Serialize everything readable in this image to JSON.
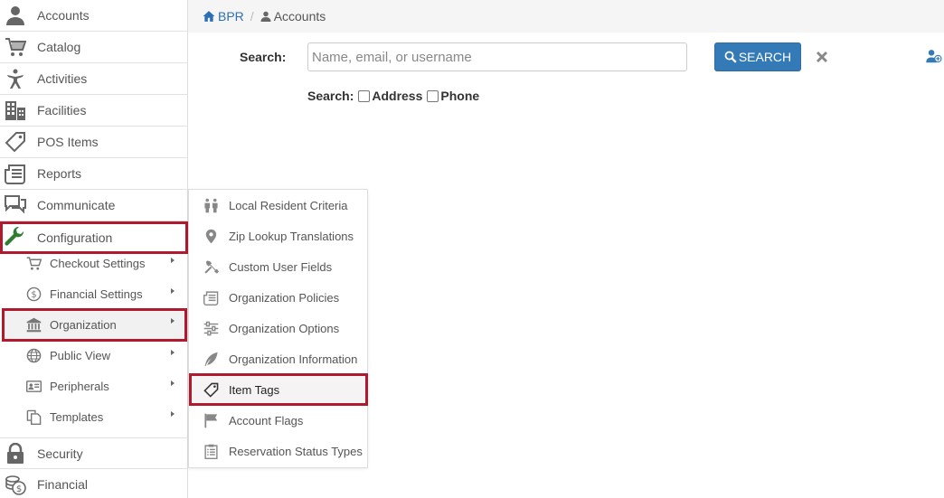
{
  "breadcrumb": {
    "home": "BPR",
    "separator": "/",
    "current": "Accounts"
  },
  "search": {
    "label": "Search:",
    "placeholder": "Name, email, or username",
    "value": "",
    "button_label": "SEARCH",
    "options_label": "Search:",
    "options": [
      "Address",
      "Phone"
    ]
  },
  "sidebar": {
    "items": [
      {
        "label": "Accounts",
        "icon": "user-icon"
      },
      {
        "label": "Catalog",
        "icon": "cart-icon"
      },
      {
        "label": "Activities",
        "icon": "person-activity-icon"
      },
      {
        "label": "Facilities",
        "icon": "building-icon"
      },
      {
        "label": "POS Items",
        "icon": "tag-icon"
      },
      {
        "label": "Reports",
        "icon": "reports-icon"
      },
      {
        "label": "Communicate",
        "icon": "chat-icon"
      },
      {
        "label": "Configuration",
        "icon": "wrench-icon"
      }
    ],
    "sub_items": [
      {
        "label": "Checkout Settings",
        "icon": "cart-icon"
      },
      {
        "label": "Financial Settings",
        "icon": "dollar-circle-icon"
      },
      {
        "label": "Organization",
        "icon": "bank-icon"
      },
      {
        "label": "Public View",
        "icon": "globe-icon"
      },
      {
        "label": "Peripherals",
        "icon": "id-card-icon"
      },
      {
        "label": "Templates",
        "icon": "copy-icon"
      }
    ],
    "bottom_items": [
      {
        "label": "Security",
        "icon": "lock-icon"
      },
      {
        "label": "Financial",
        "icon": "money-icon"
      }
    ]
  },
  "flyout": {
    "items": [
      {
        "label": "Local Resident Criteria",
        "icon": "residents-icon"
      },
      {
        "label": "Zip Lookup Translations",
        "icon": "map-pin-icon"
      },
      {
        "label": "Custom User Fields",
        "icon": "tools-icon"
      },
      {
        "label": "Organization Policies",
        "icon": "policies-icon"
      },
      {
        "label": "Organization Options",
        "icon": "sliders-icon"
      },
      {
        "label": "Organization Information",
        "icon": "feather-icon"
      },
      {
        "label": "Item Tags",
        "icon": "tag-icon"
      },
      {
        "label": "Account Flags",
        "icon": "flag-icon"
      },
      {
        "label": "Reservation Status Types",
        "icon": "clipboard-icon"
      }
    ]
  },
  "colors": {
    "accent": "#337ab7",
    "highlight": "#b1192e",
    "wrench": "#2e7d32",
    "link": "#2c6fb5"
  }
}
